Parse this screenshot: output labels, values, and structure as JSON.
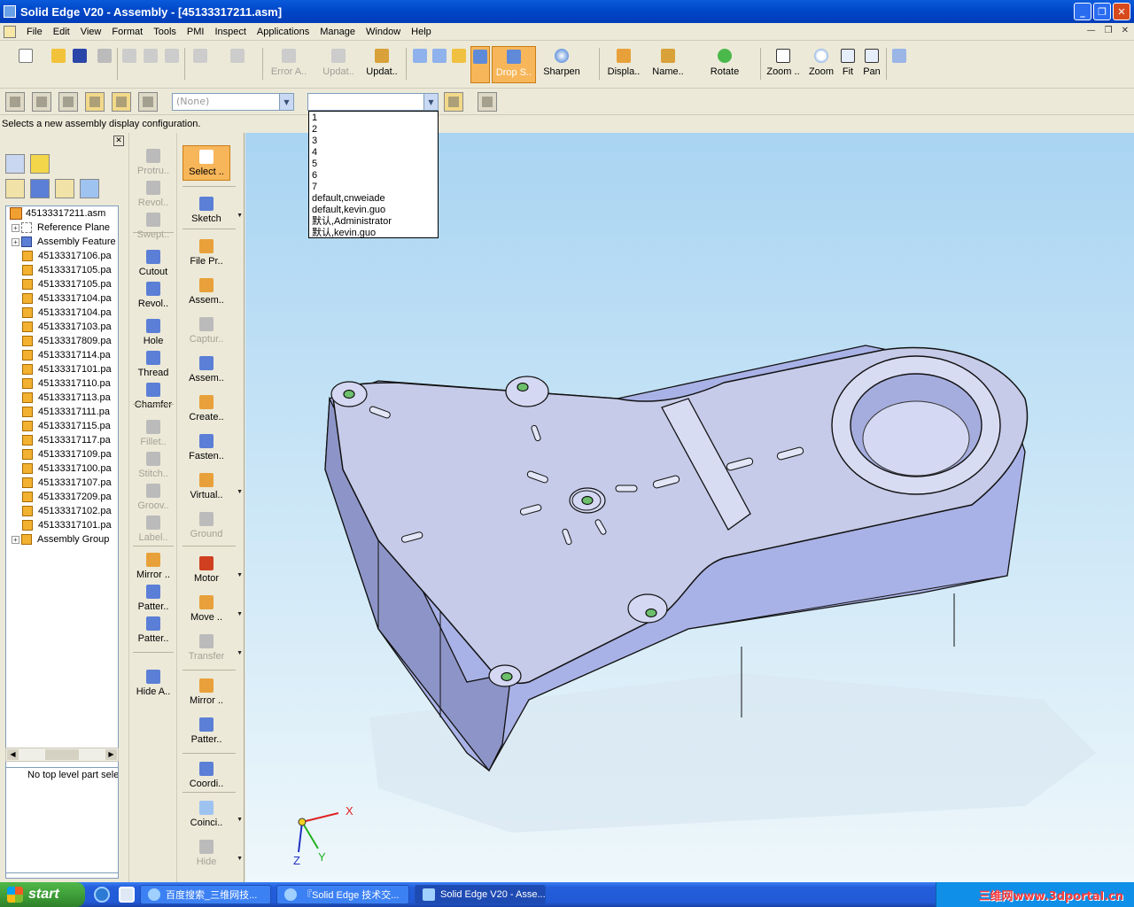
{
  "window": {
    "title": "Solid Edge V20 - Assembly - [45133317211.asm]"
  },
  "menu": [
    "File",
    "Edit",
    "View",
    "Format",
    "Tools",
    "PMI",
    "Inspect",
    "Applications",
    "Manage",
    "Window",
    "Help"
  ],
  "toolbar_main": {
    "error_label": "Error A..",
    "update_disabled_label": "Updat..",
    "update_label": "Updat..",
    "drop_label": "Drop S..",
    "sharpen_label": "Sharpen",
    "display_label": "Displa..",
    "name_label": "Name..",
    "rotate_label": "Rotate",
    "zoom_area_label": "Zoom ..",
    "zoom_label": "Zoom",
    "fit_label": "Fit",
    "pan_label": "Pan"
  },
  "toolbar2": {
    "layer_combo": "(None)",
    "config_combo": ""
  },
  "status_prompt": "Selects a new assembly display configuration.",
  "config_dropdown": [
    "1",
    "2",
    "3",
    "4",
    "5",
    "6",
    "7",
    "default,cnweiade",
    "default,kevin.guo",
    "默认,Administrator",
    "默认,kevin.guo"
  ],
  "tree": {
    "root": "45133317211.asm",
    "reference_planes": "Reference Plane",
    "assembly_features": "Assembly Feature",
    "parts": [
      "45133317106.pa",
      "45133317105.pa",
      "45133317105.pa",
      "45133317104.pa",
      "45133317104.pa",
      "45133317103.pa",
      "45133317809.pa",
      "45133317114.pa",
      "45133317101.pa",
      "45133317110.pa",
      "45133317113.pa",
      "45133317111.pa",
      "45133317115.pa",
      "45133317117.pa",
      "45133317109.pa",
      "45133317100.pa",
      "45133317107.pa",
      "45133317209.pa",
      "45133317102.pa",
      "45133317101.pa"
    ],
    "assembly_group": "Assembly Group"
  },
  "info_message": "No top level part sele",
  "feature_column": [
    "Protru..",
    "Revol..",
    "Swept..",
    "Cutout",
    "Revol..",
    "Hole",
    "Thread",
    "Chamfer",
    "Fillet..",
    "Stitch..",
    "Groov..",
    "Label..",
    "Mirror ..",
    "Patter..",
    "Patter..",
    "Hide A.."
  ],
  "assembly_column": [
    "Select ..",
    "Sketch",
    "File Pr..",
    "Assem..",
    "Captur..",
    "Assem..",
    "Create..",
    "Fasten..",
    "Virtual..",
    "Ground",
    "Motor",
    "Move ..",
    "Transfer",
    "Mirror ..",
    "Patter..",
    "Coordi..",
    "Coinci..",
    "Hide"
  ],
  "axes": {
    "x": "X",
    "y": "Y",
    "z": "Z"
  },
  "taskbar": {
    "start": "start",
    "tasks": [
      "百度搜索_三维网技...",
      "『Solid Edge 技术交...",
      "Solid Edge V20 - Asse..."
    ],
    "watermark": "三维网www.3dportal.cn"
  },
  "colors": {
    "title_bar": "#0047C9",
    "highlight": "#F7B65A",
    "model_face": "#C6CCEC"
  }
}
